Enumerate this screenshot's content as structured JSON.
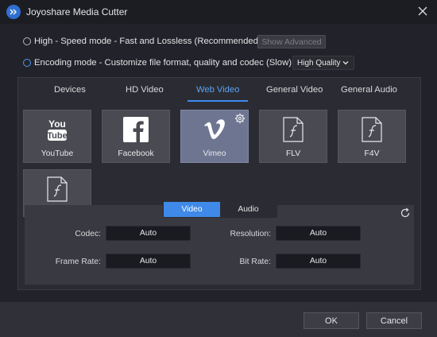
{
  "window": {
    "title": "Joyoshare Media Cutter",
    "accent_color": "#3d8bf2"
  },
  "modes": {
    "high": {
      "label": "High - Speed mode - Fast and Lossless (Recommended)",
      "selected": false
    },
    "show_advanced_label": "Show Advanced",
    "encoding": {
      "label": "Encoding mode - Customize file format, quality and codec (Slow)",
      "selected": true
    },
    "quality": {
      "value": "High Quality"
    }
  },
  "tabs": [
    {
      "label": "Devices"
    },
    {
      "label": "HD Video"
    },
    {
      "label": "Web Video",
      "active": true
    },
    {
      "label": "General Video"
    },
    {
      "label": "General Audio"
    }
  ],
  "formats": [
    {
      "label": "YouTube",
      "icon": "youtube-icon"
    },
    {
      "label": "Facebook",
      "icon": "facebook-icon"
    },
    {
      "label": "Vimeo",
      "icon": "vimeo-icon",
      "active": true
    },
    {
      "label": "FLV",
      "icon": "flash-file-icon"
    },
    {
      "label": "F4V",
      "icon": "flash-file-icon"
    },
    {
      "label": "",
      "icon": "flash-file-icon"
    }
  ],
  "settings": {
    "segments": {
      "video": "Video",
      "audio": "Audio",
      "active": "Video"
    },
    "codec": {
      "label": "Codec:",
      "value": "Auto"
    },
    "resolution": {
      "label": "Resolution:",
      "value": "Auto"
    },
    "frame_rate": {
      "label": "Frame Rate:",
      "value": "Auto"
    },
    "bit_rate": {
      "label": "Bit Rate:",
      "value": "Auto"
    }
  },
  "footer": {
    "ok_label": "OK",
    "cancel_label": "Cancel"
  }
}
